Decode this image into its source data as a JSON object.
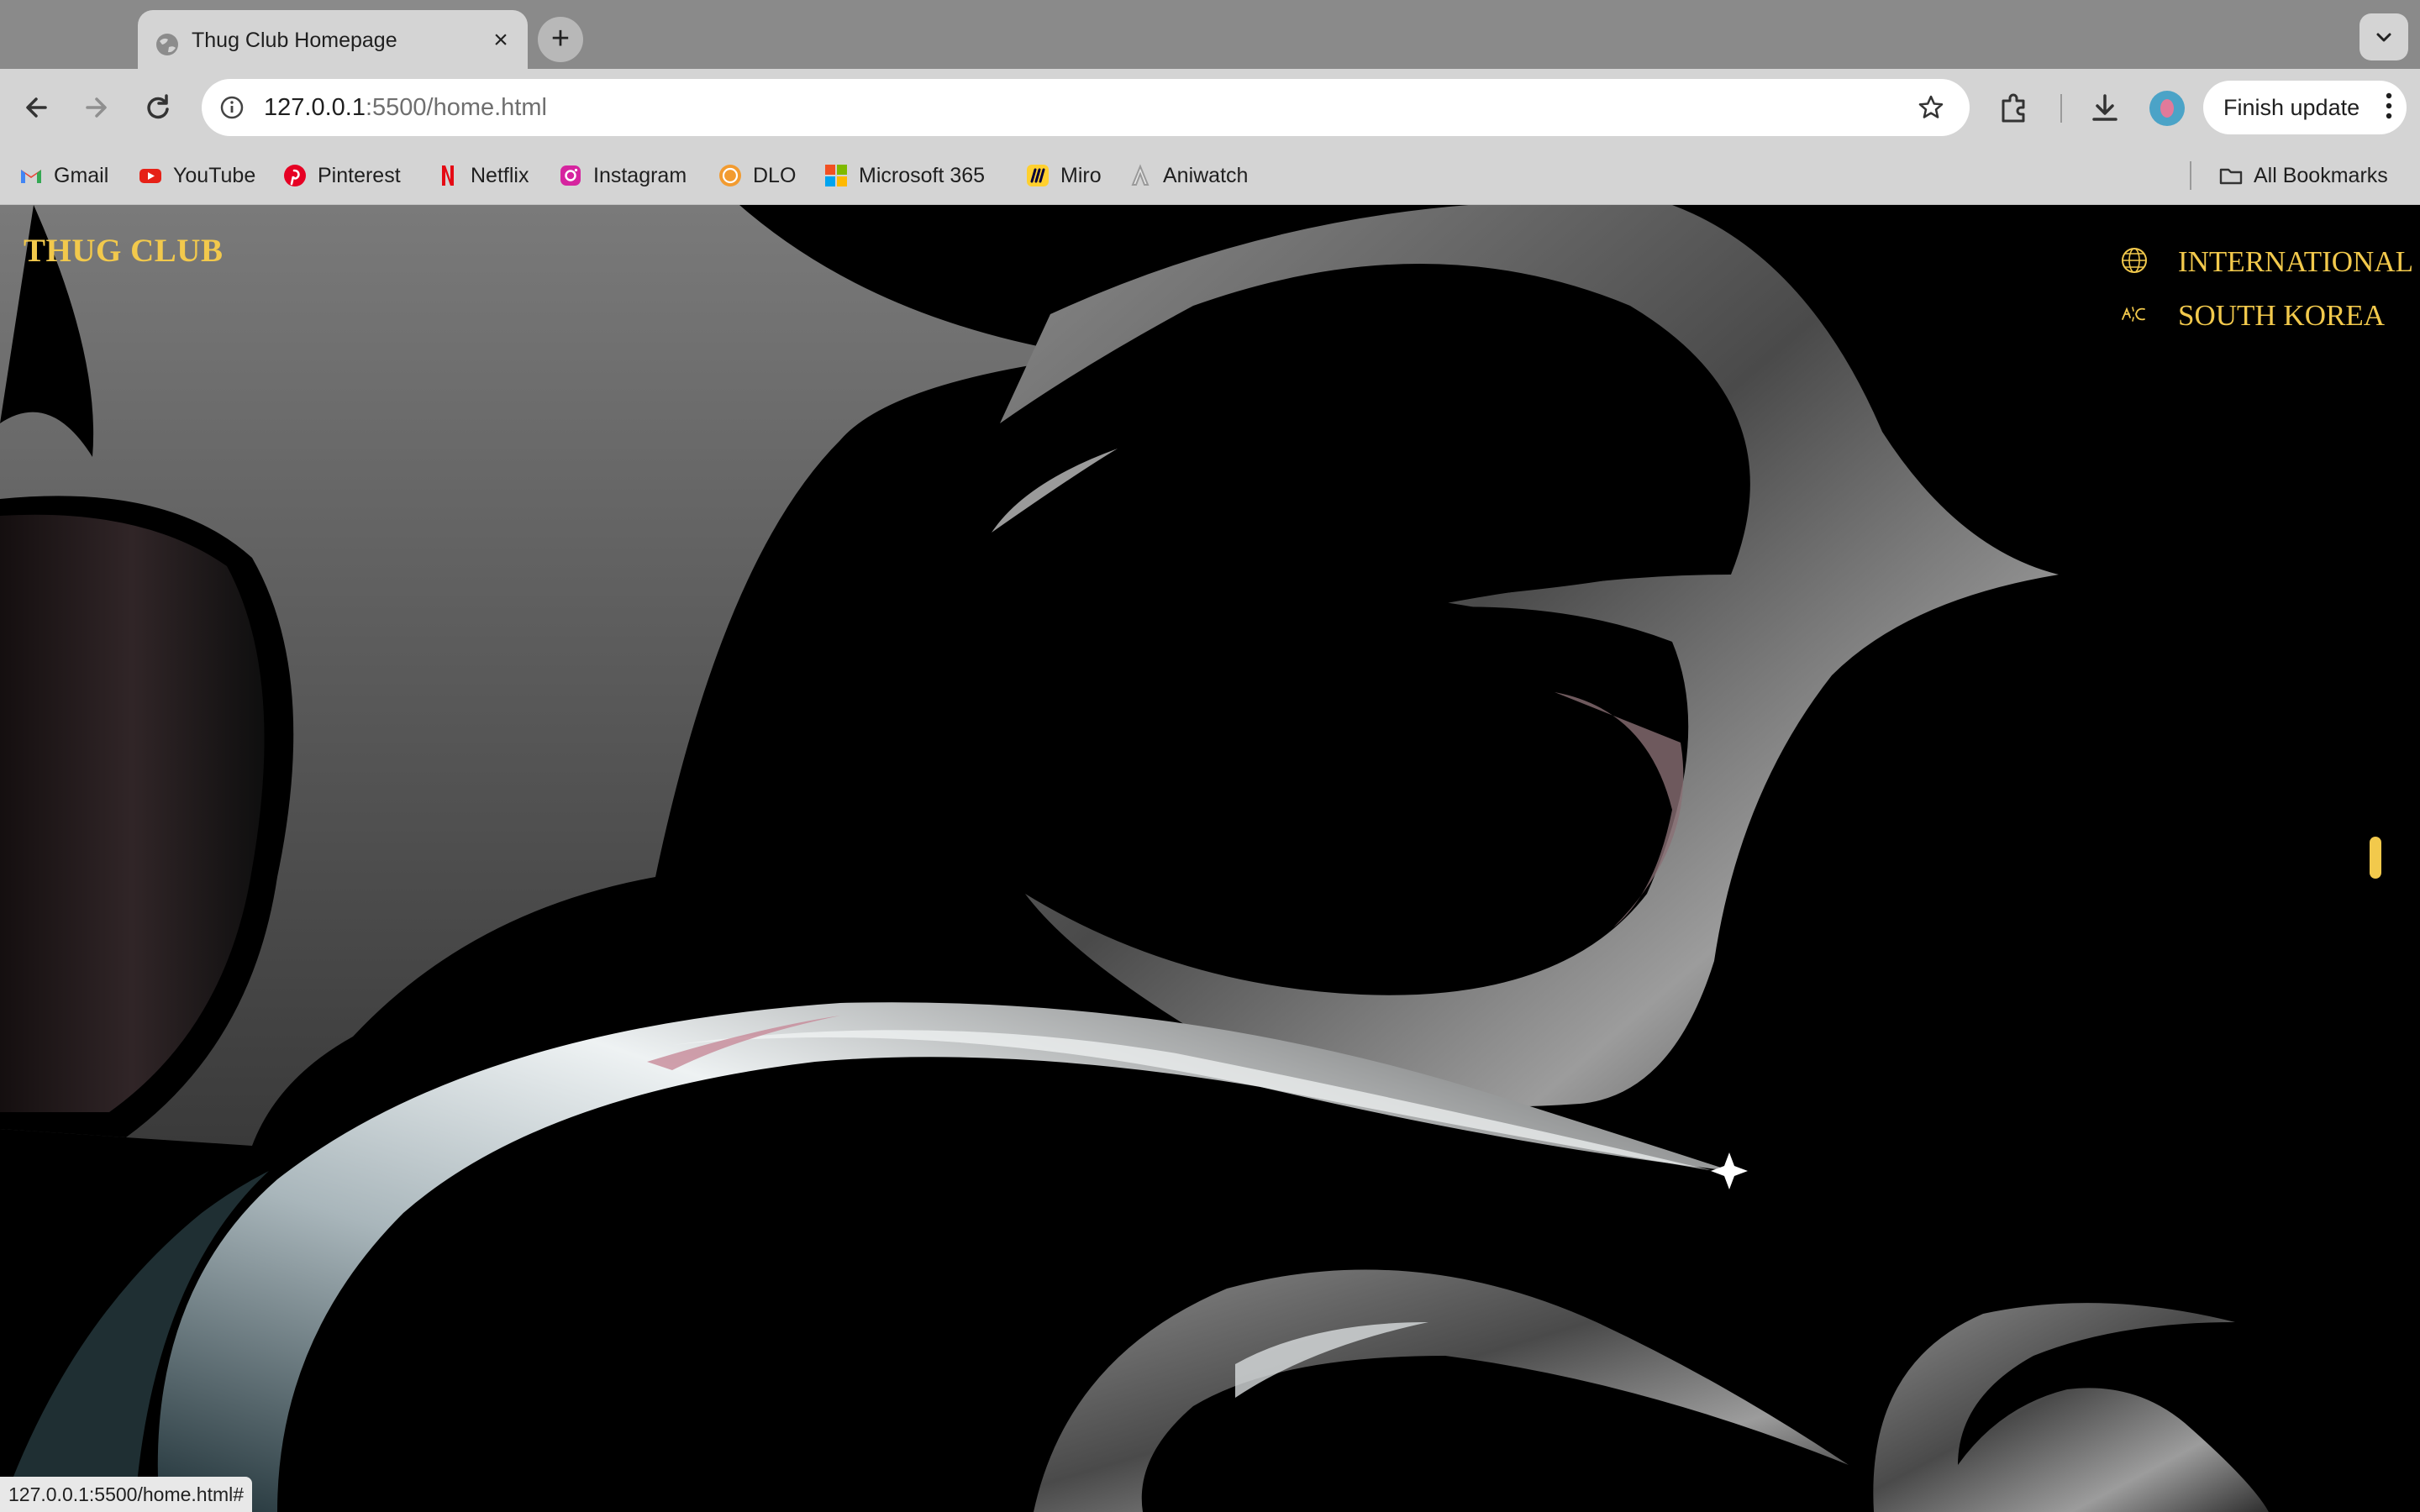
{
  "browser": {
    "tab": {
      "title": "Thug Club Homepage"
    },
    "new_tab_symbol": "+",
    "close_tab_symbol": "×",
    "address": {
      "host": "127.0.0.1",
      "rest": ":5500/home.html"
    },
    "finish_update_label": "Finish update",
    "bookmarks": [
      {
        "label": "Gmail",
        "icon": "gmail-icon"
      },
      {
        "label": "YouTube",
        "icon": "youtube-icon"
      },
      {
        "label": "Pinterest",
        "icon": "pinterest-icon"
      },
      {
        "label": "Netflix",
        "icon": "netflix-icon"
      },
      {
        "label": "Instagram",
        "icon": "instagram-icon"
      },
      {
        "label": "DLO",
        "icon": "dlo-icon"
      },
      {
        "label": "Microsoft 365",
        "icon": "microsoft-365-icon"
      },
      {
        "label": "Miro",
        "icon": "miro-icon"
      },
      {
        "label": "Aniwatch",
        "icon": "aniwatch-icon"
      }
    ],
    "all_bookmarks_label": "All Bookmarks",
    "status_url": "127.0.0.1:5500/home.html#"
  },
  "page": {
    "logo": "THUG CLUB",
    "regions": [
      {
        "label": "INTERNATIONAL",
        "icon": "globe-icon"
      },
      {
        "label": "SOUTH KOREA",
        "icon": "korea-emblem-icon"
      }
    ]
  },
  "colors": {
    "accent_gold": "#f2c94c",
    "page_background": "#000000",
    "chrome_gray": "#d4d4d4"
  }
}
